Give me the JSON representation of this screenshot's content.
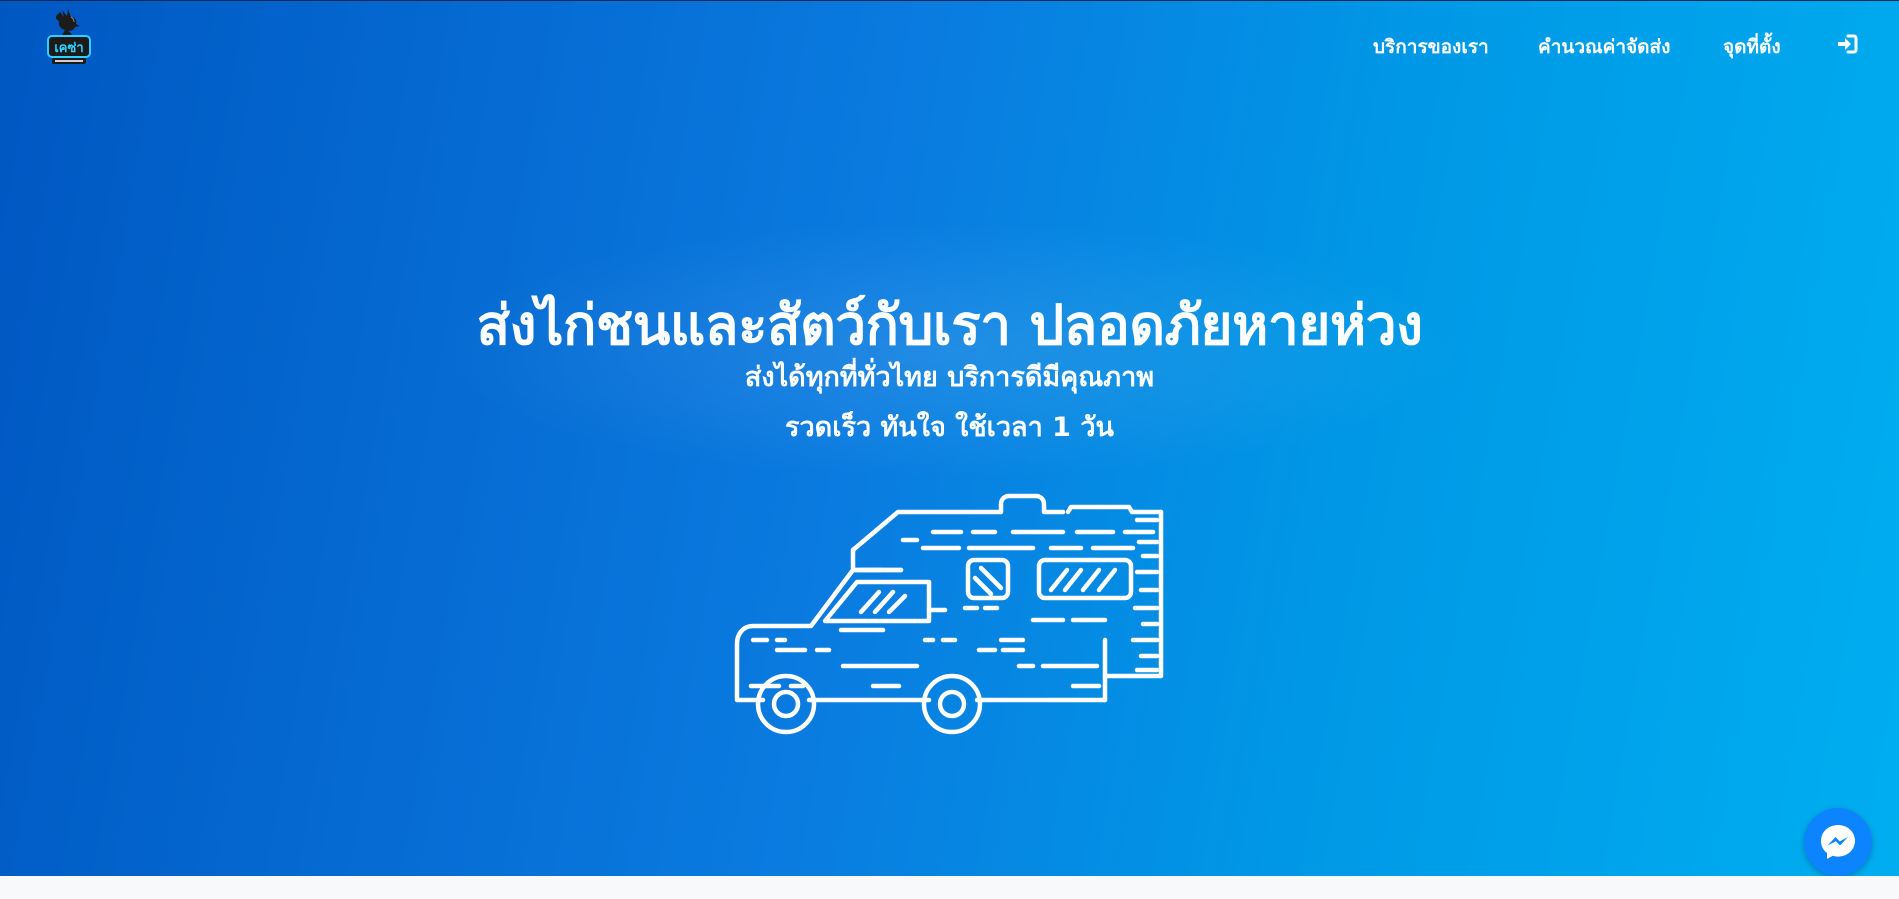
{
  "brand": {
    "logo_icon": "rooster-logo-icon",
    "logo_text": "เคซ่า"
  },
  "nav": {
    "items": [
      {
        "label": "บริการของเรา"
      },
      {
        "label": "คำนวณค่าจัดส่ง"
      },
      {
        "label": "จุดที่ตั้ง"
      }
    ],
    "login_icon": "sign-in-icon"
  },
  "hero": {
    "headline": "ส่งไก่ชนและสัตว์กับเรา ปลอดภัยหายห่วง",
    "subline_1": "ส่งได้ทุกที่ทั่วไทย บริการดีมีคุณภาพ",
    "subline_2": "รวดเร็ว ทันใจ ใช้เวลา 1 วัน",
    "illustration_icon": "delivery-truck-icon"
  },
  "chat": {
    "icon": "messenger-icon"
  },
  "colors": {
    "gradient_start": "#0057c2",
    "gradient_end": "#00aef0",
    "text": "#ffffff",
    "messenger": "#0d84ff"
  }
}
